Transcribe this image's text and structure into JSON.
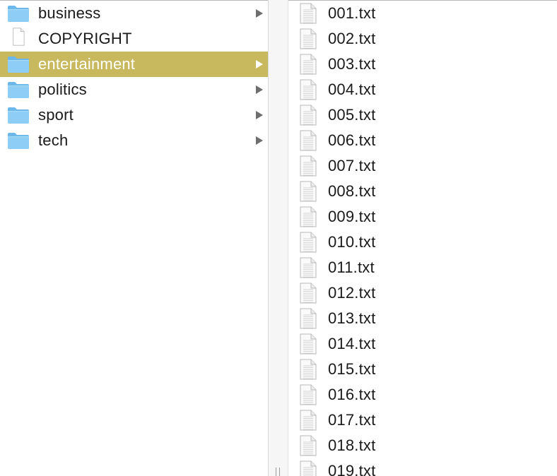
{
  "folders": [
    {
      "label": "business",
      "kind": "folder",
      "has_children": true,
      "selected": false
    },
    {
      "label": "COPYRIGHT",
      "kind": "file",
      "has_children": false,
      "selected": false
    },
    {
      "label": "entertainment",
      "kind": "folder",
      "has_children": true,
      "selected": true
    },
    {
      "label": "politics",
      "kind": "folder",
      "has_children": true,
      "selected": false
    },
    {
      "label": "sport",
      "kind": "folder",
      "has_children": true,
      "selected": false
    },
    {
      "label": "tech",
      "kind": "folder",
      "has_children": true,
      "selected": false
    }
  ],
  "files": [
    "001.txt",
    "002.txt",
    "003.txt",
    "004.txt",
    "005.txt",
    "006.txt",
    "007.txt",
    "008.txt",
    "009.txt",
    "010.txt",
    "011.txt",
    "012.txt",
    "013.txt",
    "014.txt",
    "015.txt",
    "016.txt",
    "017.txt",
    "018.txt",
    "019.txt"
  ],
  "colors": {
    "selection": "#c8b95e",
    "folder_fill": "#8ecdf5",
    "folder_tab": "#6cb8ea",
    "chevron": "#6e6e6e",
    "text": "#1a1a1a"
  },
  "icons": {
    "folder": "folder-icon",
    "document": "document-icon",
    "text_file": "text-file-icon",
    "expand": "chevron-right-icon"
  }
}
